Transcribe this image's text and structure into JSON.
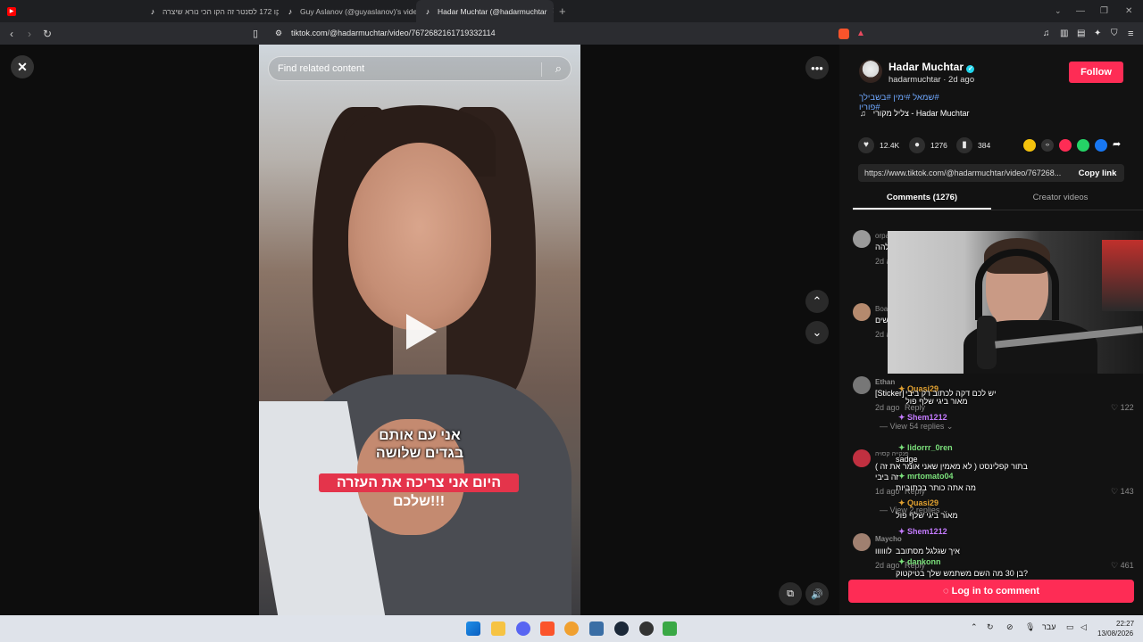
{
  "browser": {
    "tabs": [
      {
        "title": "",
        "icon": "youtube-icon"
      },
      {
        "title": "קו 172 לסנטר זה הקו הכי נורא שיצרה",
        "icon": "tiktok-icon"
      },
      {
        "title": "Guy Aslanov (@guyaslanov)'s videos",
        "icon": "tiktok-icon"
      },
      {
        "title": "Hadar Muchtar (@hadarmuchtar",
        "icon": "tiktok-icon",
        "active": true
      }
    ],
    "new_tab": "+",
    "url": "tiktok.com/@hadarmuchtar/video/7672682161719332114"
  },
  "video": {
    "search_placeholder": "Find related content",
    "caption_line1": "אני עם אותם",
    "caption_line2": "בגדים שלושה",
    "caption_red": "היום אני צריכה את העזרה שלכם!!!"
  },
  "author": {
    "name": "Hadar Muchtar",
    "handle_date": "hadarmuchtar · 2d ago",
    "follow_label": "Follow",
    "hashtags": "#שמאל #ימין #בשבילך #פוריו",
    "sound": "צליל מקורי - Hadar Muchtar"
  },
  "stats": {
    "likes": "12.4K",
    "comments": "1276",
    "saves": "384"
  },
  "link": {
    "url": "https://www.tiktok.com/@hadarmuchtar/video/767268...",
    "copy_label": "Copy link"
  },
  "tabs": {
    "comments": "Comments (1276)",
    "creator": "Creator videos"
  },
  "comments": [
    {
      "user": "orpa",
      "text": "להה",
      "date": "2d a"
    },
    {
      "user": "Boa",
      "text": "שים",
      "date": "2d a"
    },
    {
      "user": "Ethan",
      "text": "[Sticker]",
      "date": "2d ago",
      "reply": "Reply",
      "likes": "122",
      "view_replies": "View 54 replies"
    },
    {
      "user": "פנקייה קסויה",
      "text": "בתור קפלינסט ( לא מאמין שאני אומר את זה )",
      "text2": "זה ביבי",
      "date": "1d ago",
      "reply": "Reply",
      "likes": "143",
      "view_replies": "View 2 replies"
    },
    {
      "user": "Maycho",
      "text": "לוווווו",
      "date": "2d ago",
      "reply": "Reply",
      "likes": "461"
    }
  ],
  "chat": [
    {
      "name": "Quasi29",
      "color": "#e0a030",
      "msg": "יש לכם דקה לכתוב רק ביבי"
    },
    {
      "name": "",
      "color": "#ffffff",
      "msg": "מאור ביגי שלף פול"
    },
    {
      "name": "Shem1212",
      "color": "#c47bff",
      "msg": ""
    },
    {
      "name": "lidorrr_0ren",
      "color": "#7be07b",
      "msg": "sadge"
    },
    {
      "name": "mrtomato04",
      "color": "#7be07b",
      "msg": "מה אתה כותר בכתוביות"
    },
    {
      "name": "Quasi29",
      "color": "#e0a030",
      "msg": "מאור ביגי שלף פול"
    },
    {
      "name": "Shem1212",
      "color": "#c47bff",
      "msg": "איך שגלגל מסתובב"
    },
    {
      "name": "dankonn",
      "color": "#7be07b",
      "msg": "בן 30 מה השם משתמש שלך בטיקטוק?"
    }
  ],
  "login_label": "Log in to comment",
  "taskbar": {
    "lang": "עבר",
    "time": "22:27",
    "date": "13/08/2026"
  }
}
